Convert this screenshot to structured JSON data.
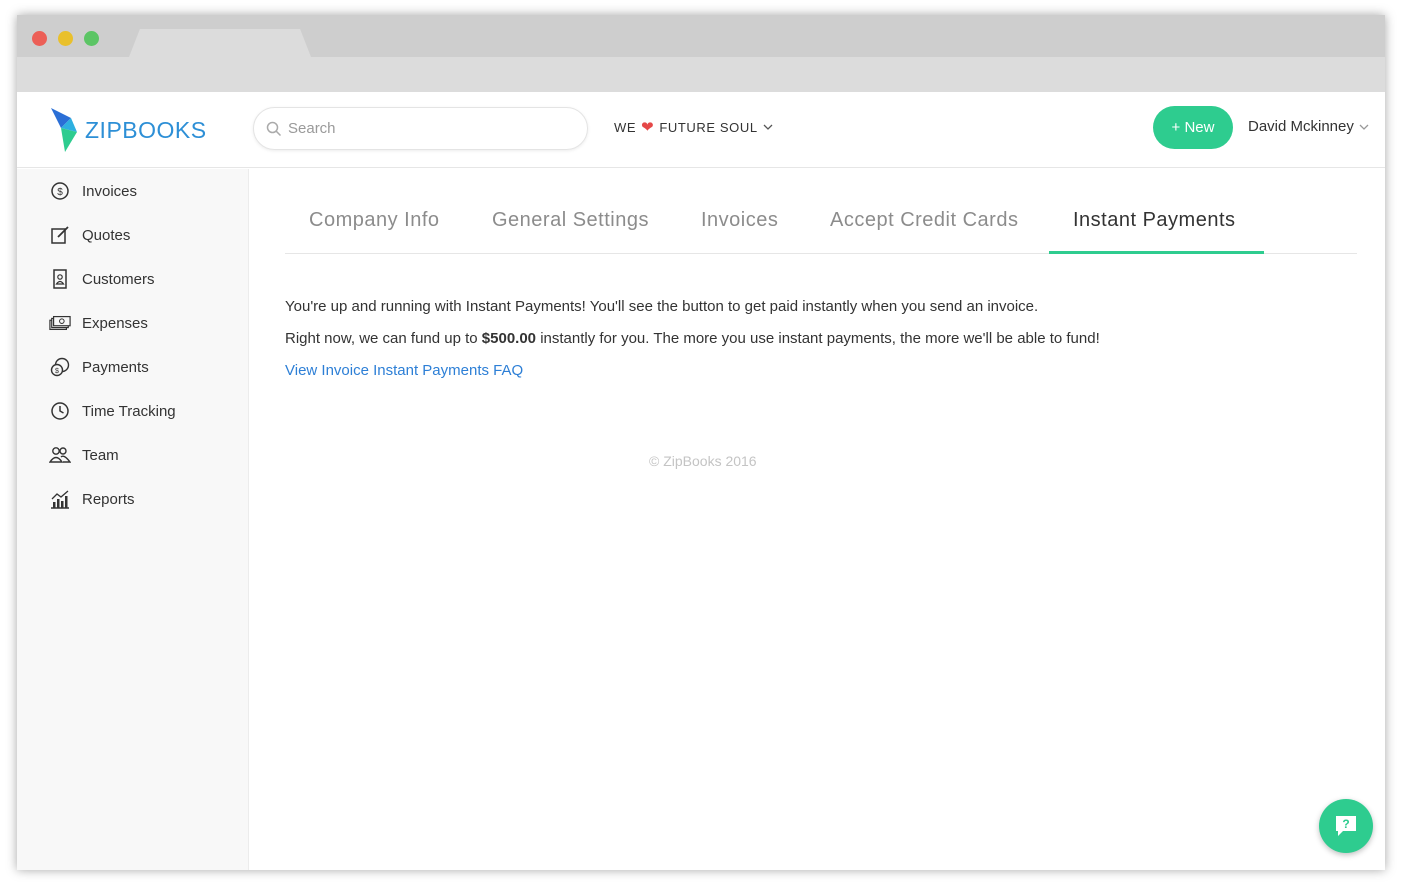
{
  "brand": {
    "name": "ZIPBOOKS"
  },
  "search": {
    "placeholder": "Search"
  },
  "company": {
    "prefix": "WE",
    "heart": "❤",
    "name": "FUTURE SOUL"
  },
  "header": {
    "new_label": "+ New",
    "user_name": "David Mckinney"
  },
  "sidebar": {
    "items": [
      {
        "label": "Invoices",
        "icon": "dollar-circle-icon"
      },
      {
        "label": "Quotes",
        "icon": "edit-icon"
      },
      {
        "label": "Customers",
        "icon": "contact-book-icon"
      },
      {
        "label": "Expenses",
        "icon": "cash-stack-icon"
      },
      {
        "label": "Payments",
        "icon": "coins-icon"
      },
      {
        "label": "Time Tracking",
        "icon": "clock-icon"
      },
      {
        "label": "Team",
        "icon": "team-icon"
      },
      {
        "label": "Reports",
        "icon": "bar-chart-icon"
      }
    ]
  },
  "tabs": [
    {
      "label": "Company Info"
    },
    {
      "label": "General Settings"
    },
    {
      "label": "Invoices"
    },
    {
      "label": "Accept Credit Cards"
    },
    {
      "label": "Instant Payments",
      "active": true
    }
  ],
  "content": {
    "line1": "You're up and running with Instant Payments! You'll see the button to get paid instantly when you send an invoice.",
    "line2_prefix": "Right now, we can fund up to ",
    "line2_amount": "$500.00",
    "line2_suffix": " instantly for you. The more you use instant payments, the more we'll be able to fund!",
    "faq_link": "View Invoice Instant Payments FAQ"
  },
  "footer": {
    "copyright": "© ZipBooks 2016"
  },
  "colors": {
    "accent": "#2ecc8f",
    "link": "#2d7fd6",
    "brand": "#2d8fd6"
  }
}
